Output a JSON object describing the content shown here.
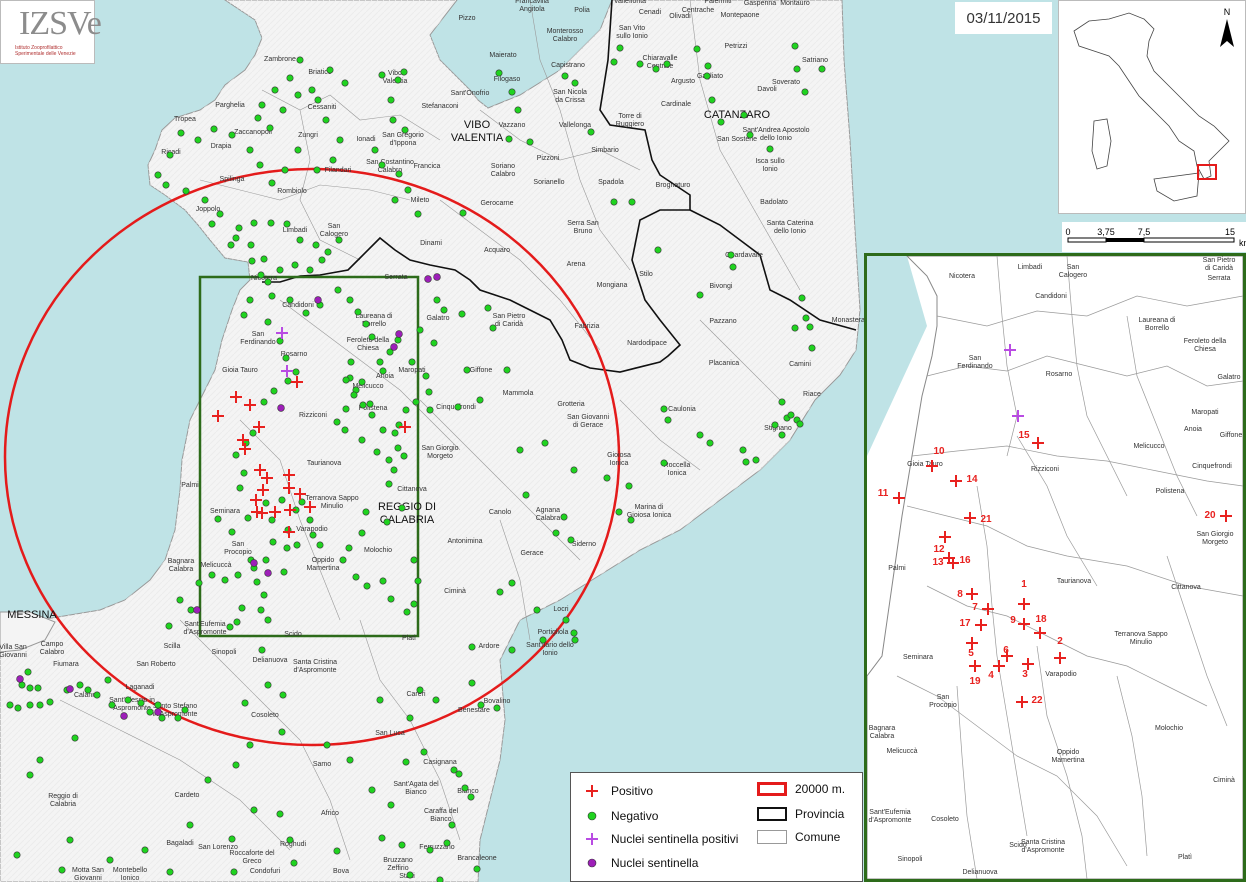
{
  "date": "03/11/2015",
  "logo": {
    "text": "IZSVe",
    "subtitle": "Istituto Zooprofilattico",
    "subtitle2": "Sperimentale delle Venezie"
  },
  "scale": {
    "ticks": [
      "0",
      "3,75",
      "7,5",
      "15"
    ],
    "unit": "km"
  },
  "north": "N",
  "legend": {
    "positivo": "Positivo",
    "negativo": "Negativo",
    "nuclei_pos": "Nuclei sentinella positivi",
    "nuclei": "Nuclei sentinella",
    "radius": "20000 m.",
    "provincia": "Provincia",
    "comune": "Comune"
  },
  "colors": {
    "sea": "#bfe3e6",
    "positive": "#e8211f",
    "negative": "#1fd31f",
    "sentinel_pos": "#b94be3",
    "sentinel": "#9d1fb8",
    "circle": "#e41b1b",
    "frame": "#2d6b1a"
  },
  "provinces": [
    {
      "name": "VIBO VALENTIA",
      "lines": [
        "VIBO",
        "VALENTIA"
      ]
    },
    {
      "name": "CATANZARO",
      "lines": [
        "CATANZARO"
      ]
    },
    {
      "name": "REGGIO DI CALABRIA",
      "lines": [
        "REGGIO DI",
        "CALABRIA"
      ]
    },
    {
      "name": "MESSINA",
      "lines": [
        "MESSINA"
      ]
    }
  ],
  "towns_main": [
    {
      "name": "Pizzo"
    },
    {
      "name": "Francavilla Angitola"
    },
    {
      "name": "Polia"
    },
    {
      "name": "Vallefiorita"
    },
    {
      "name": "Centrache"
    },
    {
      "name": "Cenadi"
    },
    {
      "name": "Olivadi"
    },
    {
      "name": "Palermiti"
    },
    {
      "name": "Gasperina"
    },
    {
      "name": "Montauro"
    },
    {
      "name": "Montepaone"
    },
    {
      "name": "Monterosso Calabro"
    },
    {
      "name": "San Vito sullo Ionio"
    },
    {
      "name": "Petrizzi"
    },
    {
      "name": "Zambrone"
    },
    {
      "name": "Briatico"
    },
    {
      "name": "Vibo Valentia"
    },
    {
      "name": "Maierato"
    },
    {
      "name": "Capistrano"
    },
    {
      "name": "Chiaravalle Centrale"
    },
    {
      "name": "Argusto"
    },
    {
      "name": "Gagliato"
    },
    {
      "name": "Soverato"
    },
    {
      "name": "Satriano"
    },
    {
      "name": "Filogaso"
    },
    {
      "name": "San Nicola da Crissa"
    },
    {
      "name": "Davoli"
    },
    {
      "name": "Parghelia"
    },
    {
      "name": "Cessaniti"
    },
    {
      "name": "Sant'Onofrio"
    },
    {
      "name": "Stefanaconi"
    },
    {
      "name": "Cardinale"
    },
    {
      "name": "Tropea"
    },
    {
      "name": "Zaccanopoli"
    },
    {
      "name": "Vazzano"
    },
    {
      "name": "Vallelonga"
    },
    {
      "name": "Torre di Ruggiero"
    },
    {
      "name": "Zungri"
    },
    {
      "name": "Ionadi"
    },
    {
      "name": "San Gregorio d'Ippona"
    },
    {
      "name": "Sant'Andrea Apostolo dello Ionio"
    },
    {
      "name": "Ricadi"
    },
    {
      "name": "Drapia"
    },
    {
      "name": "Pizzoni"
    },
    {
      "name": "Simbario"
    },
    {
      "name": "San Sostene"
    },
    {
      "name": "Isca sullo Ionio"
    },
    {
      "name": "Filandari"
    },
    {
      "name": "San Costantino Calabro"
    },
    {
      "name": "Francica"
    },
    {
      "name": "Soriano Calabro"
    },
    {
      "name": "Spilinga"
    },
    {
      "name": "Rombiolo"
    },
    {
      "name": "Sorianello"
    },
    {
      "name": "Spadola"
    },
    {
      "name": "Brognaturo"
    },
    {
      "name": "Mileto"
    },
    {
      "name": "Badolato"
    },
    {
      "name": "Gerocarne"
    },
    {
      "name": "Joppolo"
    },
    {
      "name": "Limbadi"
    },
    {
      "name": "San Calogero"
    },
    {
      "name": "Serra San Bruno"
    },
    {
      "name": "Santa Caterina dello Ionio"
    },
    {
      "name": "Dinami"
    },
    {
      "name": "Acquaro"
    },
    {
      "name": "Guardavalle"
    },
    {
      "name": "Arena"
    },
    {
      "name": "Stilo"
    },
    {
      "name": "Bivongi"
    },
    {
      "name": "Nicotera"
    },
    {
      "name": "Candidoni"
    },
    {
      "name": "Serrata"
    },
    {
      "name": "Mongiana"
    },
    {
      "name": "Laureana di Borrello"
    },
    {
      "name": "Galatro"
    },
    {
      "name": "San Pietro di Caridà"
    },
    {
      "name": "Pazzano"
    },
    {
      "name": "Monasterace"
    },
    {
      "name": "San Ferdinando"
    },
    {
      "name": "Fabrizia"
    },
    {
      "name": "Feroleto della Chiesa"
    },
    {
      "name": "Nardodipace"
    },
    {
      "name": "Rosarno"
    },
    {
      "name": "Maropati"
    },
    {
      "name": "Giffone"
    },
    {
      "name": "Placanica"
    },
    {
      "name": "Camini"
    },
    {
      "name": "Gioia Tauro"
    },
    {
      "name": "Anoia"
    },
    {
      "name": "Melicucco"
    },
    {
      "name": "Mammola"
    },
    {
      "name": "Riace"
    },
    {
      "name": "Rizziconi"
    },
    {
      "name": "Polistena"
    },
    {
      "name": "Cinquefrondi"
    },
    {
      "name": "Grotteria"
    },
    {
      "name": "San Giovanni di Gerace"
    },
    {
      "name": "Caulonia"
    },
    {
      "name": "Stignano"
    },
    {
      "name": "San Giorgio Morgeto"
    },
    {
      "name": "Gioiosa Ionica"
    },
    {
      "name": "Taurianova"
    },
    {
      "name": "Roccella Ionica"
    },
    {
      "name": "Palmi"
    },
    {
      "name": "Cittanova"
    },
    {
      "name": "Seminara"
    },
    {
      "name": "Terranova Sappo Minulio"
    },
    {
      "name": "Canolo"
    },
    {
      "name": "Marina di Gioiosa Ionica"
    },
    {
      "name": "Varapodio"
    },
    {
      "name": "Agnana Calabra"
    },
    {
      "name": "San Procopio"
    },
    {
      "name": "Siderno"
    },
    {
      "name": "Molochio"
    },
    {
      "name": "Antonimina"
    },
    {
      "name": "Bagnara Calabra"
    },
    {
      "name": "Oppido Mamertina"
    },
    {
      "name": "Gerace"
    },
    {
      "name": "Melicuccà"
    },
    {
      "name": "Ciminà"
    },
    {
      "name": "Locri"
    },
    {
      "name": "Portigliola"
    },
    {
      "name": "Sant'Ilario dello Ionio"
    },
    {
      "name": "Sant'Eufemia d'Aspromonte"
    },
    {
      "name": "Scido"
    },
    {
      "name": "Platì"
    },
    {
      "name": "Villa San Giovanni"
    },
    {
      "name": "Campo Calabro"
    },
    {
      "name": "Scilla"
    },
    {
      "name": "Sinopoli"
    },
    {
      "name": "Delianuova"
    },
    {
      "name": "Santa Cristina d'Aspromonte"
    },
    {
      "name": "Ardore"
    },
    {
      "name": "Fiumara"
    },
    {
      "name": "San Roberto"
    },
    {
      "name": "Calanna"
    },
    {
      "name": "Laganadi"
    },
    {
      "name": "Sant'Alessio in Aspromonte"
    },
    {
      "name": "Santo Stefano in Aspromonte"
    },
    {
      "name": "Careri"
    },
    {
      "name": "Bovalino"
    },
    {
      "name": "Benestare"
    },
    {
      "name": "Cosoleto"
    },
    {
      "name": "San Luca"
    },
    {
      "name": "Reggio di Calabria"
    },
    {
      "name": "Samo"
    },
    {
      "name": "Casignana"
    },
    {
      "name": "Sant'Agata del Bianco"
    },
    {
      "name": "Bianco"
    },
    {
      "name": "Caraffa del Bianco"
    },
    {
      "name": "Cardeto"
    },
    {
      "name": "Africo"
    },
    {
      "name": "Bagaladi"
    },
    {
      "name": "San Lorenzo"
    },
    {
      "name": "Roccaforte del Greco"
    },
    {
      "name": "Roghudi"
    },
    {
      "name": "Ferruzzano"
    },
    {
      "name": "Brancaleone"
    },
    {
      "name": "Motta San Giovanni"
    },
    {
      "name": "Montebello Ionico"
    },
    {
      "name": "Condofuri"
    },
    {
      "name": "Bova"
    },
    {
      "name": "Bruzzano Zeffirio"
    },
    {
      "name": "Staiti"
    }
  ],
  "towns_inset": [
    {
      "name": "Nicotera"
    },
    {
      "name": "Limbadi"
    },
    {
      "name": "San Calogero"
    },
    {
      "name": "San Pietro di Caridà"
    },
    {
      "name": "Serrata"
    },
    {
      "name": "Candidoni"
    },
    {
      "name": "Laureana di Borrello"
    },
    {
      "name": "San Ferdinando"
    },
    {
      "name": "Rosarno"
    },
    {
      "name": "Feroleto della Chiesa"
    },
    {
      "name": "Galatro"
    },
    {
      "name": "Maropati"
    },
    {
      "name": "Anoia"
    },
    {
      "name": "Giffone"
    },
    {
      "name": "Melicucco"
    },
    {
      "name": "Gioia Tauro"
    },
    {
      "name": "Rizziconi"
    },
    {
      "name": "Cinquefrondi"
    },
    {
      "name": "Polistena"
    },
    {
      "name": "San Giorgio Morgeto"
    },
    {
      "name": "Palmi"
    },
    {
      "name": "Taurianova"
    },
    {
      "name": "Cittanova"
    },
    {
      "name": "Terranova Sappo Minulio"
    },
    {
      "name": "Seminara"
    },
    {
      "name": "Varapodio"
    },
    {
      "name": "San Procopio"
    },
    {
      "name": "Molochio"
    },
    {
      "name": "Bagnara Calabra"
    },
    {
      "name": "Melicuccà"
    },
    {
      "name": "Oppido Mamertina"
    },
    {
      "name": "Ciminà"
    },
    {
      "name": "Sant'Eufemia d'Aspromonte"
    },
    {
      "name": "Cosoleto"
    },
    {
      "name": "Scido"
    },
    {
      "name": "Santa Cristina d'Aspromonte"
    },
    {
      "name": "Sinopoli"
    },
    {
      "name": "Delianuova"
    },
    {
      "name": "Platì"
    }
  ],
  "inset_positive_ids": [
    "1",
    "2",
    "3",
    "4",
    "5",
    "6",
    "7",
    "8",
    "9",
    "10",
    "11",
    "12",
    "13",
    "14",
    "15",
    "16",
    "17",
    "18",
    "19",
    "20",
    "21",
    "22"
  ]
}
